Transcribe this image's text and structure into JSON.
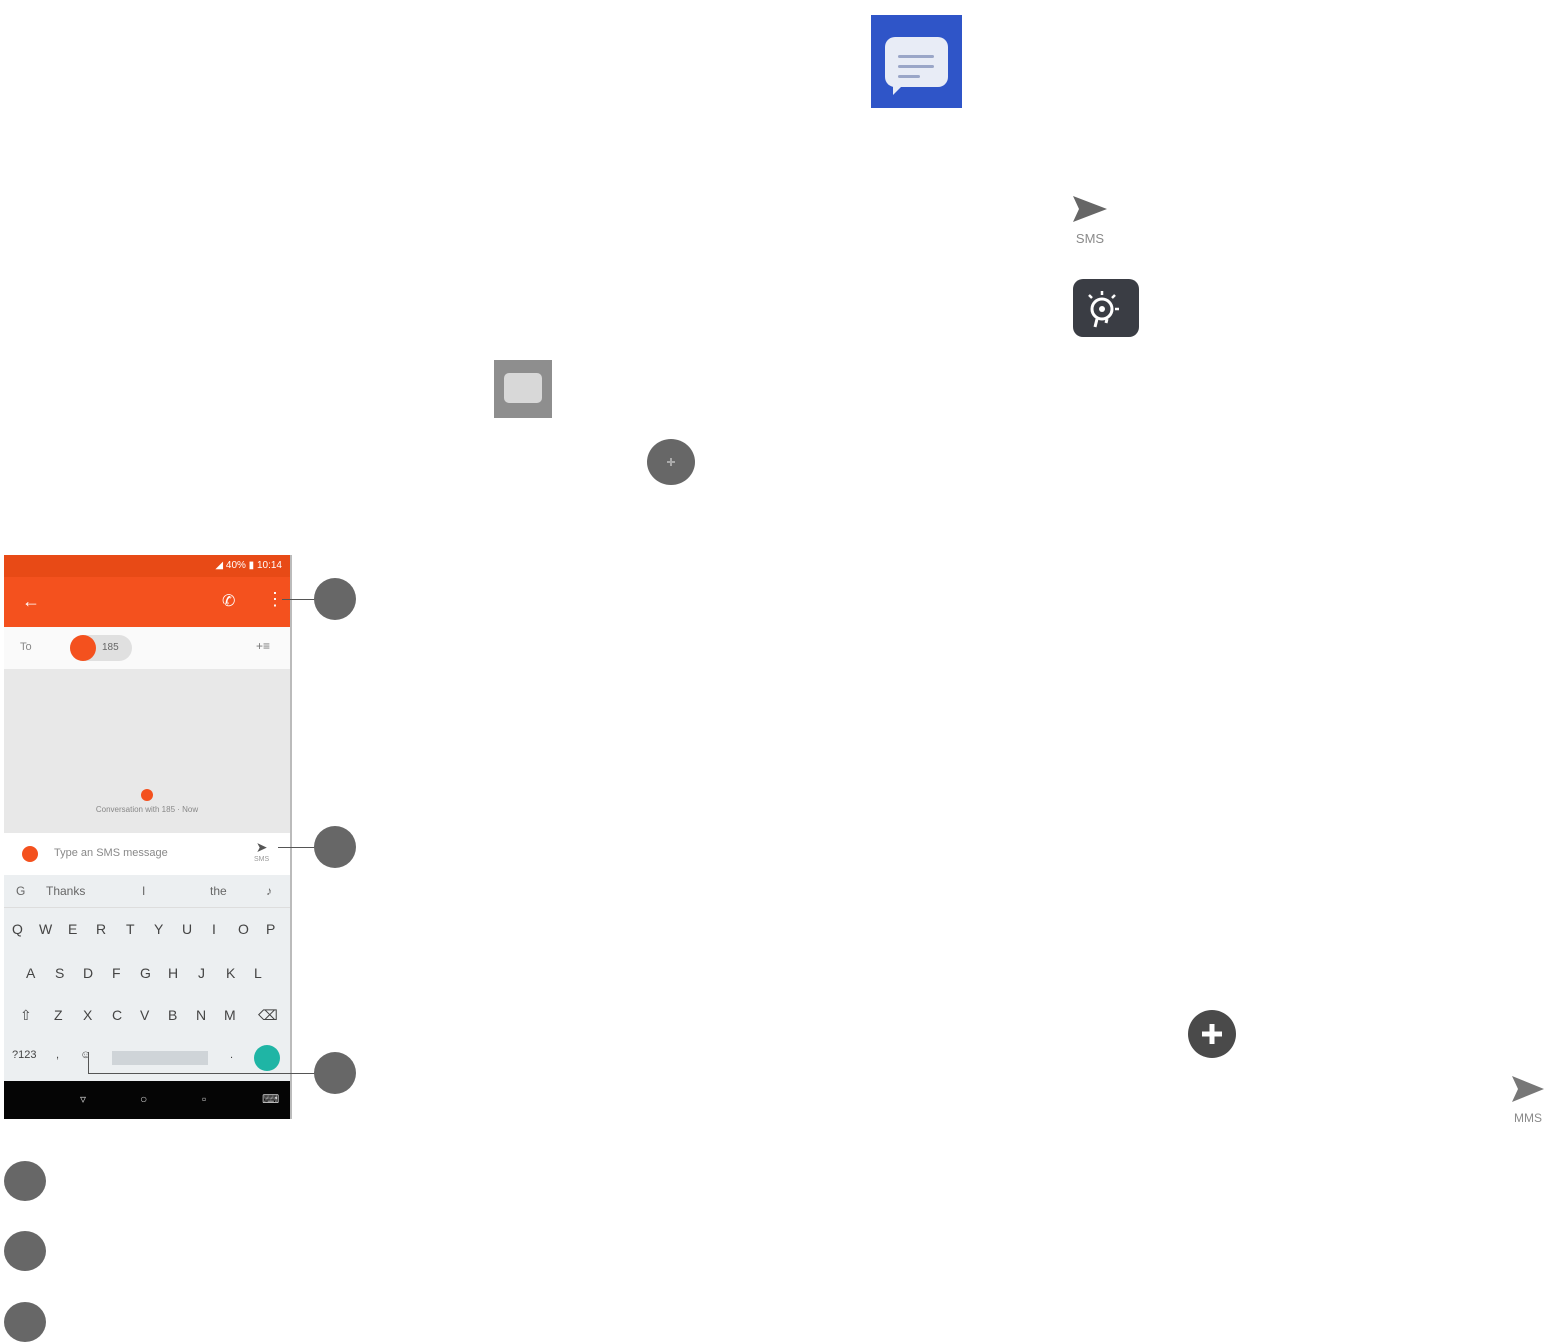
{
  "top_icons": {
    "sms_send_label": "SMS",
    "mms_send_label": "MMS"
  },
  "phone": {
    "status_text": "◢ 40% ▮ 10:14",
    "to_label": "To",
    "recipient_chip": "185",
    "conversation_caption": "Conversation with 185 · Now",
    "compose_placeholder": "Type an SMS message",
    "compose_send_label": "SMS",
    "suggestions": [
      "Thanks",
      "I",
      "the"
    ],
    "keyboard_rows": [
      [
        "Q",
        "W",
        "E",
        "R",
        "T",
        "Y",
        "U",
        "I",
        "O",
        "P"
      ],
      [
        "A",
        "S",
        "D",
        "F",
        "G",
        "H",
        "J",
        "K",
        "L"
      ],
      [
        "Z",
        "X",
        "C",
        "V",
        "B",
        "N",
        "M"
      ]
    ],
    "symbols_key": "?123",
    "comma_key": ",",
    "period_key": "."
  },
  "colors": {
    "app_bar": "#f4511e",
    "messages_icon": "#2f55c8",
    "callout_dot": "#676767"
  }
}
